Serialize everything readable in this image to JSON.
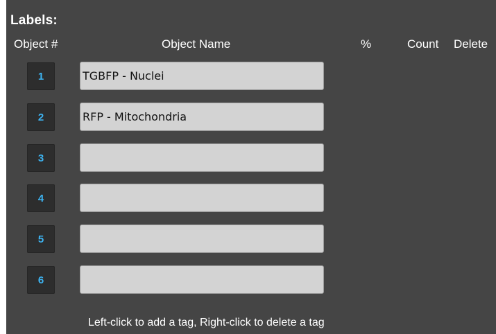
{
  "panel": {
    "title": "Labels:",
    "columns": {
      "object_num": "Object #",
      "object_name": "Object Name",
      "percent": "%",
      "count": "Count",
      "delete": "Delete"
    },
    "rows": [
      {
        "number": "1",
        "name": "TGBFP - Nuclei"
      },
      {
        "number": "2",
        "name": "RFP - Mitochondria"
      },
      {
        "number": "3",
        "name": ""
      },
      {
        "number": "4",
        "name": ""
      },
      {
        "number": "5",
        "name": ""
      },
      {
        "number": "6",
        "name": ""
      }
    ],
    "hint": "Left-click to add a tag, Right-click to delete a tag"
  },
  "colors": {
    "panel_background": "#454545",
    "button_background": "#2d2d2d",
    "button_text": "#3db4f2",
    "input_background": "#d3d3d3",
    "text": "#ffffff"
  }
}
